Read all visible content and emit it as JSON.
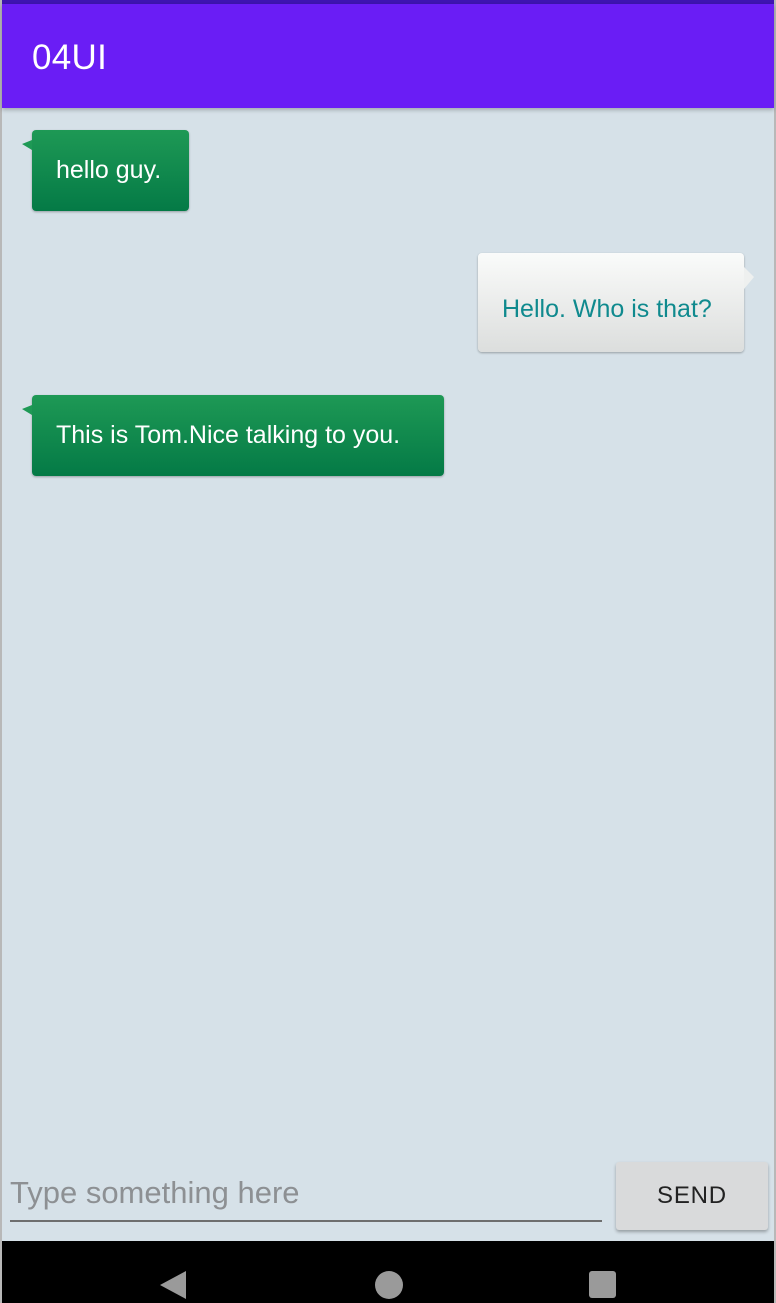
{
  "colors": {
    "accent": "#6a1df5",
    "received_bubble": "#0b854c",
    "sent_bubble": "#ebedec",
    "sent_text": "#0f8a8e",
    "background": "#d6e1e8"
  },
  "app_bar": {
    "title": "04UI"
  },
  "messages": [
    {
      "type": "received",
      "text": "hello guy."
    },
    {
      "type": "sent",
      "text": "Hello. Who is that?"
    },
    {
      "type": "received",
      "text": "This is Tom.Nice talking to you."
    }
  ],
  "input": {
    "value": "",
    "placeholder": "Type something here"
  },
  "send_button": {
    "label": "SEND"
  },
  "nav_bar": {
    "icons": [
      "back-icon",
      "home-icon",
      "recents-icon"
    ]
  }
}
